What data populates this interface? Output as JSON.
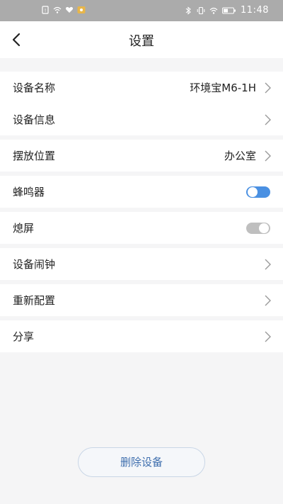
{
  "status_bar": {
    "time": "11:48",
    "left_icons": [
      "sim-icon",
      "wifi-icon",
      "heart-icon",
      "notification-icon"
    ],
    "right_icons": [
      "bluetooth-icon",
      "vibrate-icon",
      "wifi-icon",
      "battery-icon"
    ]
  },
  "nav": {
    "back_icon": "chevron-left-icon",
    "title": "设置"
  },
  "rows": {
    "device_name": {
      "label": "设备名称",
      "value": "环境宝M6-1H"
    },
    "device_info": {
      "label": "设备信息"
    },
    "location": {
      "label": "摆放位置",
      "value": "办公室"
    },
    "buzzer": {
      "label": "蜂鸣器",
      "state": "on"
    },
    "screen_off": {
      "label": "熄屏",
      "state": "off"
    },
    "alarm": {
      "label": "设备闹钟"
    },
    "reconfigure": {
      "label": "重新配置"
    },
    "share": {
      "label": "分享"
    }
  },
  "delete_button": {
    "label": "删除设备"
  },
  "colors": {
    "accent": "#4a90e2",
    "toggle_off": "#bfbfbf",
    "background": "#f5f5f6",
    "status_bar": "#ababab"
  }
}
